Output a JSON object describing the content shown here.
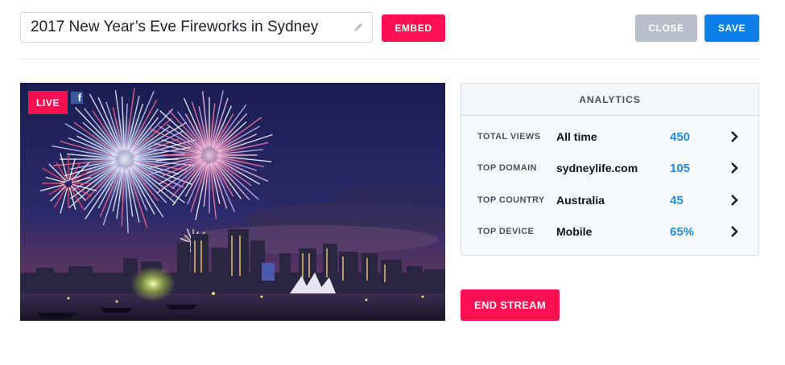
{
  "title_field": {
    "value": "2017 New Year’s Eve Fireworks in Sydney"
  },
  "toolbar": {
    "embed_label": "EMBED",
    "close_label": "CLOSE",
    "save_label": "SAVE"
  },
  "video": {
    "live_label": "LIVE",
    "social_icon": "facebook-icon"
  },
  "analytics": {
    "title": "ANALYTICS",
    "rows": [
      {
        "label": "TOTAL VIEWS",
        "value": "All time",
        "number": "450"
      },
      {
        "label": "TOP DOMAIN",
        "value": "sydneylife.com",
        "number": "105"
      },
      {
        "label": "TOP COUNTRY",
        "value": "Australia",
        "number": "45"
      },
      {
        "label": "TOP DEVICE",
        "value": "Mobile",
        "number": "65%"
      }
    ]
  },
  "actions": {
    "end_stream_label": "END STREAM"
  },
  "colors": {
    "accent_red": "#ff0f4f",
    "accent_blue": "#0a7fe8",
    "muted": "#b9bfca",
    "stat_blue": "#1e8de8"
  }
}
